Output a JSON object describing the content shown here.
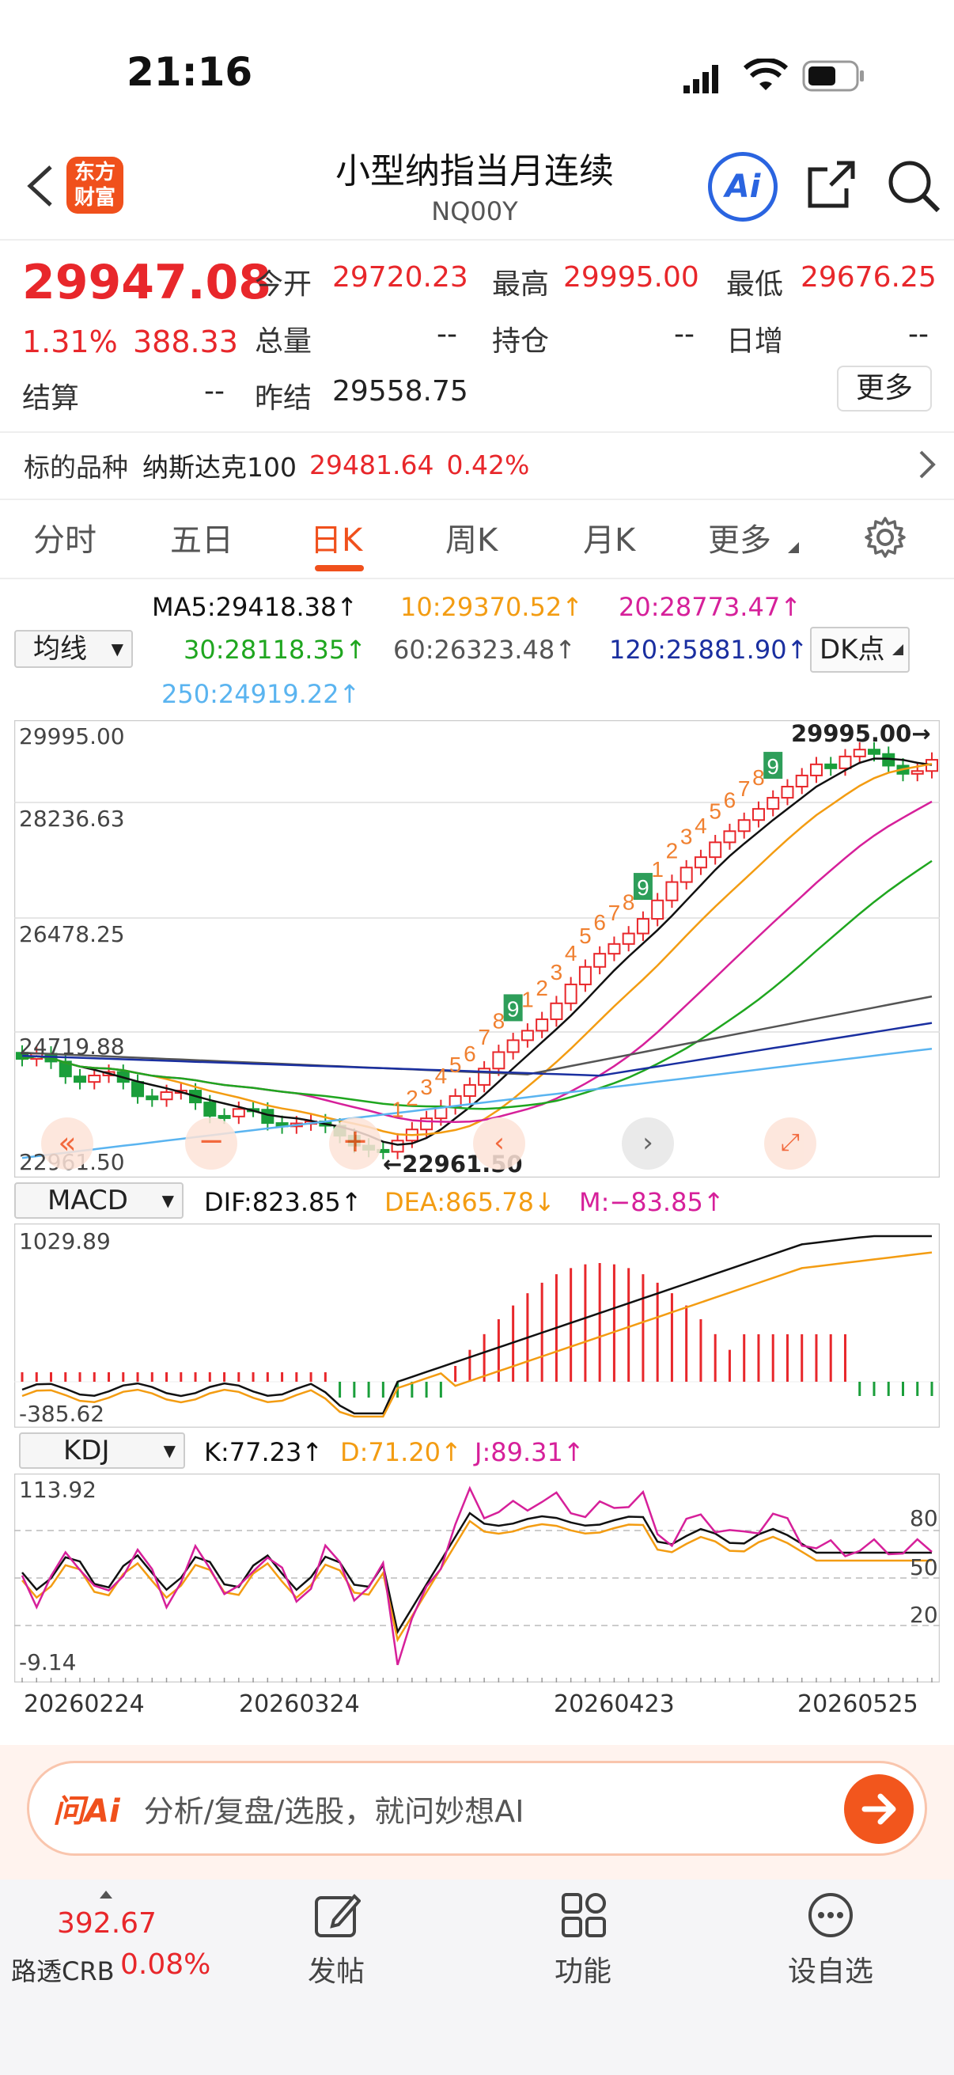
{
  "status": {
    "time": "21:16"
  },
  "header": {
    "logo_text": "东方\n财富",
    "title": "小型纳指当月连续",
    "code": "NQ00Y",
    "ai_label": "Ai"
  },
  "quote": {
    "price": "29947.08",
    "change_pct": "1.31%",
    "change": "388.33",
    "open_label": "今开",
    "open": "29720.23",
    "high_label": "最高",
    "high": "29995.00",
    "low_label": "最低",
    "low": "29676.25",
    "volume_label": "总量",
    "volume": "--",
    "oi_label": "持仓",
    "oi": "--",
    "daily_inc_label": "日增",
    "daily_inc": "--",
    "settle_label": "结算",
    "settle": "--",
    "prev_settle_label": "昨结",
    "prev_settle": "29558.75",
    "more_label": "更多"
  },
  "underlying": {
    "label": "标的品种",
    "name": "纳斯达克100",
    "price": "29481.64",
    "pct": "0.42%"
  },
  "tabs": [
    "分时",
    "五日",
    "日K",
    "周K",
    "月K",
    "更多"
  ],
  "active_tab": "日K",
  "ma": {
    "selector": "均线",
    "ma5": "MA5:29418.38↑",
    "ma10": "10:29370.52↑",
    "ma20": "20:28773.47↑",
    "ma30": "30:28118.35↑",
    "ma60": "60:26323.48↑",
    "ma120": "120:25881.90↑",
    "ma250": "250:24919.22↑",
    "dk_label": "DK点"
  },
  "kline": {
    "y_labels": [
      "29995.00",
      "28236.63",
      "26478.25",
      "24719.88",
      "22961.50"
    ],
    "high_marker": "29995.00→",
    "low_marker": "←22961.50",
    "watermark": "东方财富",
    "td_labels": [
      "1",
      "2",
      "3",
      "4",
      "5",
      "6",
      "7",
      "8",
      "9",
      "1",
      "2",
      "3",
      "4",
      "5",
      "6",
      "7",
      "8",
      "9",
      "1",
      "2",
      "3",
      "4",
      "5",
      "6",
      "7",
      "8",
      "9"
    ]
  },
  "macd": {
    "selector": "MACD",
    "dif": "DIF:823.85↑",
    "dea": "DEA:865.78↓",
    "m": "M:−83.85↑",
    "y_top": "1029.89",
    "y_bottom": "-385.62"
  },
  "kdj": {
    "selector": "KDJ",
    "k": "K:77.23↑",
    "d": "D:71.20↑",
    "j": "J:89.31↑",
    "y_top": "113.92",
    "y_bottom": "-9.14",
    "levels": [
      "80",
      "50",
      "20"
    ]
  },
  "dates": [
    "20260224",
    "20260324",
    "20260423",
    "20260525"
  ],
  "ask": {
    "logo": "问Ai",
    "placeholder": "分析/复盘/选股，就问妙想AI"
  },
  "nav": {
    "index_value": "392.67",
    "index_name": "路透CRB",
    "index_pct": "0.08%",
    "post": "发帖",
    "func": "功能",
    "watch": "设自选"
  },
  "colors": {
    "up": "#e8272b",
    "down": "#1a9e3a",
    "accent": "#f0501c",
    "ma5": "#111111",
    "ma10": "#f39c12",
    "ma20": "#d6209a",
    "ma30": "#1fa61f",
    "ma60": "#555555",
    "ma120": "#1a2fa0",
    "ma250": "#5ab4f0"
  }
}
